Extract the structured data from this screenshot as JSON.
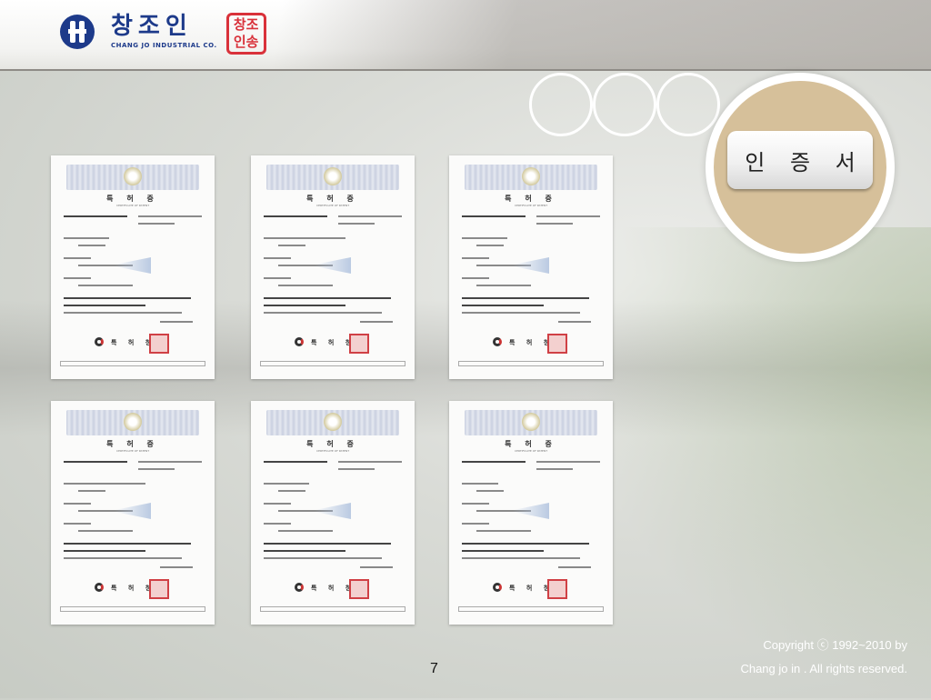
{
  "header": {
    "logo_korean": "창조인",
    "logo_english": "CHANG JO INDUSTRIAL CO.",
    "seal_line1": "창조",
    "seal_line2": "인송",
    "brand_color": "#1d3a8a",
    "seal_color": "#d9313a"
  },
  "title": {
    "label": "인 증 서",
    "disc_color": "#d6c09a"
  },
  "certificates": [
    {
      "heading": "특 허 증",
      "subheading": "CERTIFICATE OF PATENT",
      "office": "특 허 청"
    },
    {
      "heading": "특 허 증",
      "subheading": "CERTIFICATE OF PATENT",
      "office": "특 허 청"
    },
    {
      "heading": "특 허 증",
      "subheading": "CERTIFICATE OF PATENT",
      "office": "특 허 청"
    },
    {
      "heading": "특 허 증",
      "subheading": "CERTIFICATE OF PATENT",
      "office": "특 허 청"
    },
    {
      "heading": "특 허 증",
      "subheading": "CERTIFICATE OF PATENT",
      "office": "특 허 청"
    },
    {
      "heading": "특 허 증",
      "subheading": "CERTIFICATE OF PATENT",
      "office": "특 허 청"
    }
  ],
  "footer": {
    "copyright_line1": "Copyright ⓒ 1992~2010 by",
    "copyright_line2": "Chang jo in . All rights reserved.",
    "page_number": "7"
  }
}
